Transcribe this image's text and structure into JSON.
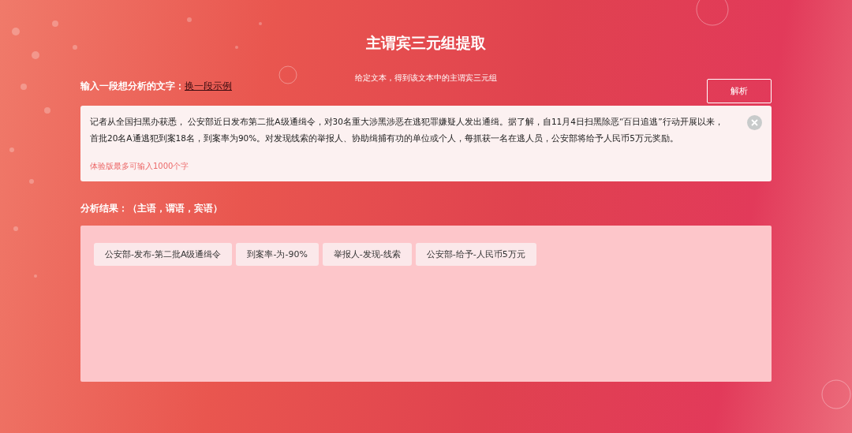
{
  "title": "主谓宾三元组提取",
  "subtitle": "给定文本，得到该文本中的主谓宾三元组",
  "input_label": "输入一段想分析的文字：",
  "example_link": "换一段示例",
  "parse_button": "解析",
  "input_text": "记者从全国扫黑办获悉， 公安部近日发布第二批A级通缉令，对30名重大涉黑涉恶在逃犯罪嫌疑人发出通缉。据了解，自11月4日扫黑除恶“百日追逃”行动开展以来，首批20名A通逃犯到案18名，到案率为90%。对发现线索的举报人、协助缉捕有功的单位或个人，每抓获一名在逃人员，公安部将给予人民币5万元奖励。",
  "limit_hint": "体验版最多可输入1000个字",
  "result_label": "分析结果：（主语，谓语，宾语）",
  "triples": [
    "公安部-发布-第二批A级通缉令",
    "到案率-为-90%",
    "举报人-发现-线索",
    "公安部-给予-人民币5万元"
  ]
}
